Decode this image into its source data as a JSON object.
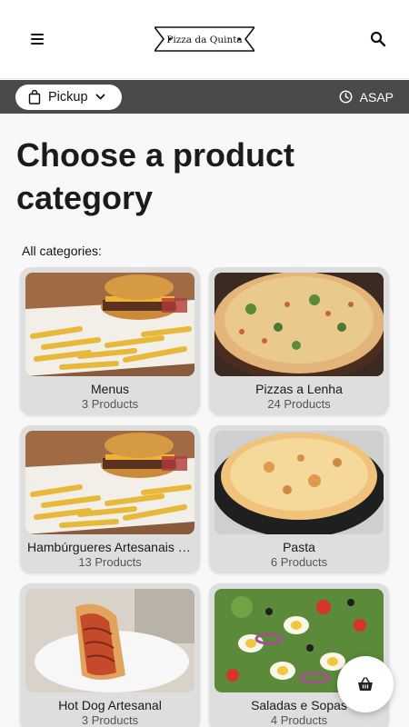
{
  "header": {
    "menu_icon": "hamburger-menu-icon",
    "logo_text": "Pizza da Quinta",
    "search_icon": "search-icon"
  },
  "order_bar": {
    "mode_label": "Pickup",
    "mode_icon": "shopping-bag-icon",
    "time_label": "ASAP",
    "time_icon": "clock-icon"
  },
  "page": {
    "title": "Choose a product category",
    "subtitle": "All categories:"
  },
  "categories": [
    {
      "name": "Menus",
      "count": "3 Products",
      "image": "burger-and-fries"
    },
    {
      "name": "Pizzas a Lenha",
      "count": "24 Products",
      "image": "pizza"
    },
    {
      "name": "Hambúrgueres Artesanais (Menu)",
      "count": "13 Products",
      "image": "burger-and-fries"
    },
    {
      "name": "Pasta",
      "count": "6 Products",
      "image": "baked-pasta"
    },
    {
      "name": "Hot Dog Artesanal",
      "count": "3 Products",
      "image": "hot-dog"
    },
    {
      "name": "Saladas e Sopas",
      "count": "4 Products",
      "image": "salad"
    }
  ],
  "cart": {
    "icon": "basket-icon"
  },
  "colors": {
    "bar": "#4a4a4a",
    "card": "#dedede",
    "background": "#f8f8f8"
  }
}
